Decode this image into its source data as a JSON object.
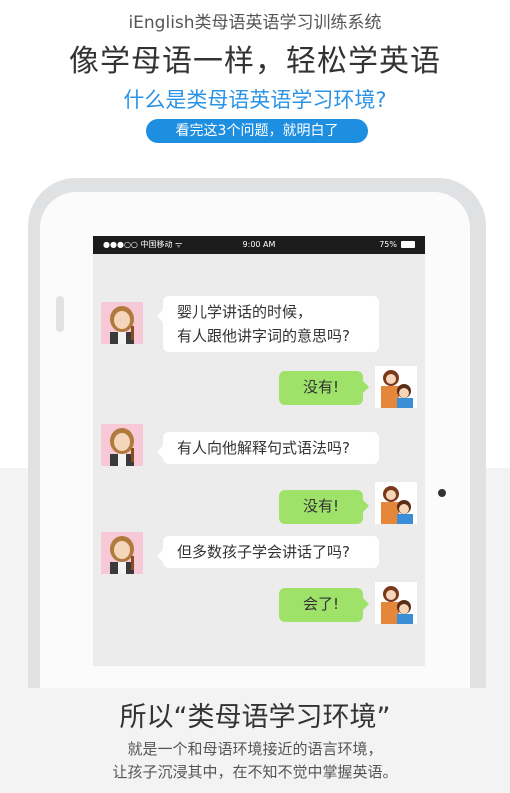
{
  "header": {
    "brand": "iEnglish类母语英语学习训练系统",
    "headline": "像学母语一样，轻松学英语",
    "question": "什么是类母语英语学习环境?",
    "cta": "看完这3个问题，就明白了"
  },
  "status_bar": {
    "carrier": "●●●○○ 中国移动 ᯤ",
    "time": "9:00 AM",
    "battery": "75%"
  },
  "chat": [
    {
      "text_line1": "婴儿学讲话的时候，",
      "text_line2": "有人跟他讲字词的意思吗?"
    },
    {
      "text": "没有!"
    },
    {
      "text": "有人向他解释句式语法吗?"
    },
    {
      "text": "没有!"
    },
    {
      "text": "但多数孩子学会讲话了吗?"
    },
    {
      "text": "会了!"
    }
  ],
  "footer": {
    "title": "所以“类母语学习环境”",
    "line1": "就是一个和母语环境接近的语言环境，",
    "line2": "让孩子沉浸其中，在不知不觉中掌握英语。"
  },
  "colors": {
    "accent": "#1e8fe0",
    "reply_bubble": "#9ee26a"
  }
}
